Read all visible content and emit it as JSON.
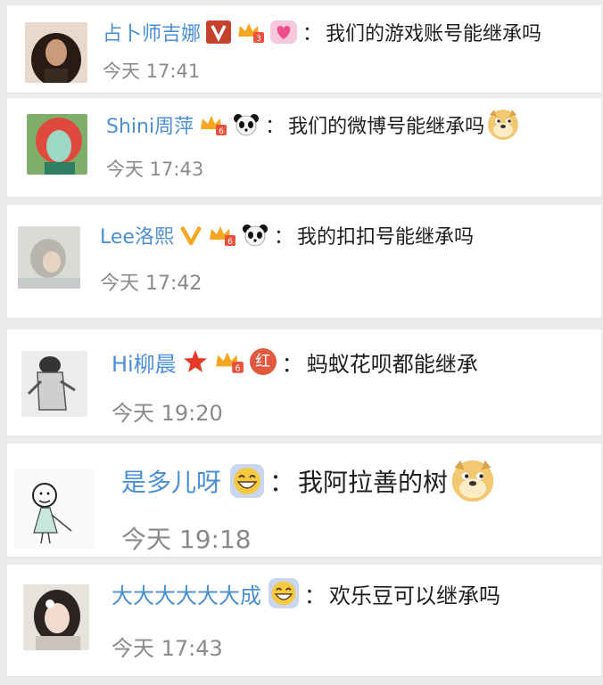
{
  "comments": [
    {
      "username": "占卜师吉娜",
      "text": "我们的游戏账号能继承吗",
      "time": "今天 17:41",
      "badges": [
        "verified-v-red-icon",
        "vip-crown-3-icon",
        "heart-emoji-icon"
      ]
    },
    {
      "username": "Shini周萍",
      "text": "我们的微博号能继承吗",
      "time": "今天 17:43",
      "badges": [
        "vip-crown-6-icon",
        "panda-emoji-icon"
      ],
      "trailing": "doge-emoji-icon"
    },
    {
      "username": "Lee洛熙",
      "text": "我的扣扣号能继承吗",
      "time": "今天 17:42",
      "badges": [
        "verified-v-orange-icon",
        "vip-crown-6-icon",
        "panda-emoji-icon"
      ]
    },
    {
      "username": "Hi柳晨",
      "text": "蚂蚁花呗都能继承",
      "time": "今天 19:20",
      "badges": [
        "red-star-icon",
        "vip-crown-6-icon",
        "red-hong-badge-icon"
      ],
      "badge_text": "红"
    },
    {
      "username": "是多儿呀",
      "text": "我阿拉善的树",
      "time": "今天 19:18",
      "badges": [
        "grin-emoji-icon"
      ],
      "trailing": "doge-emoji-icon"
    },
    {
      "username": "大大大大大大成",
      "text": "欢乐豆可以继承吗",
      "time": "今天 17:43",
      "badges": [
        "grin-emoji-icon"
      ]
    }
  ],
  "colors": {
    "username": "#4a8fd6",
    "time": "#8a8a8a",
    "text": "#1e1e1e",
    "background": "#ebebeb"
  },
  "colon": "："
}
